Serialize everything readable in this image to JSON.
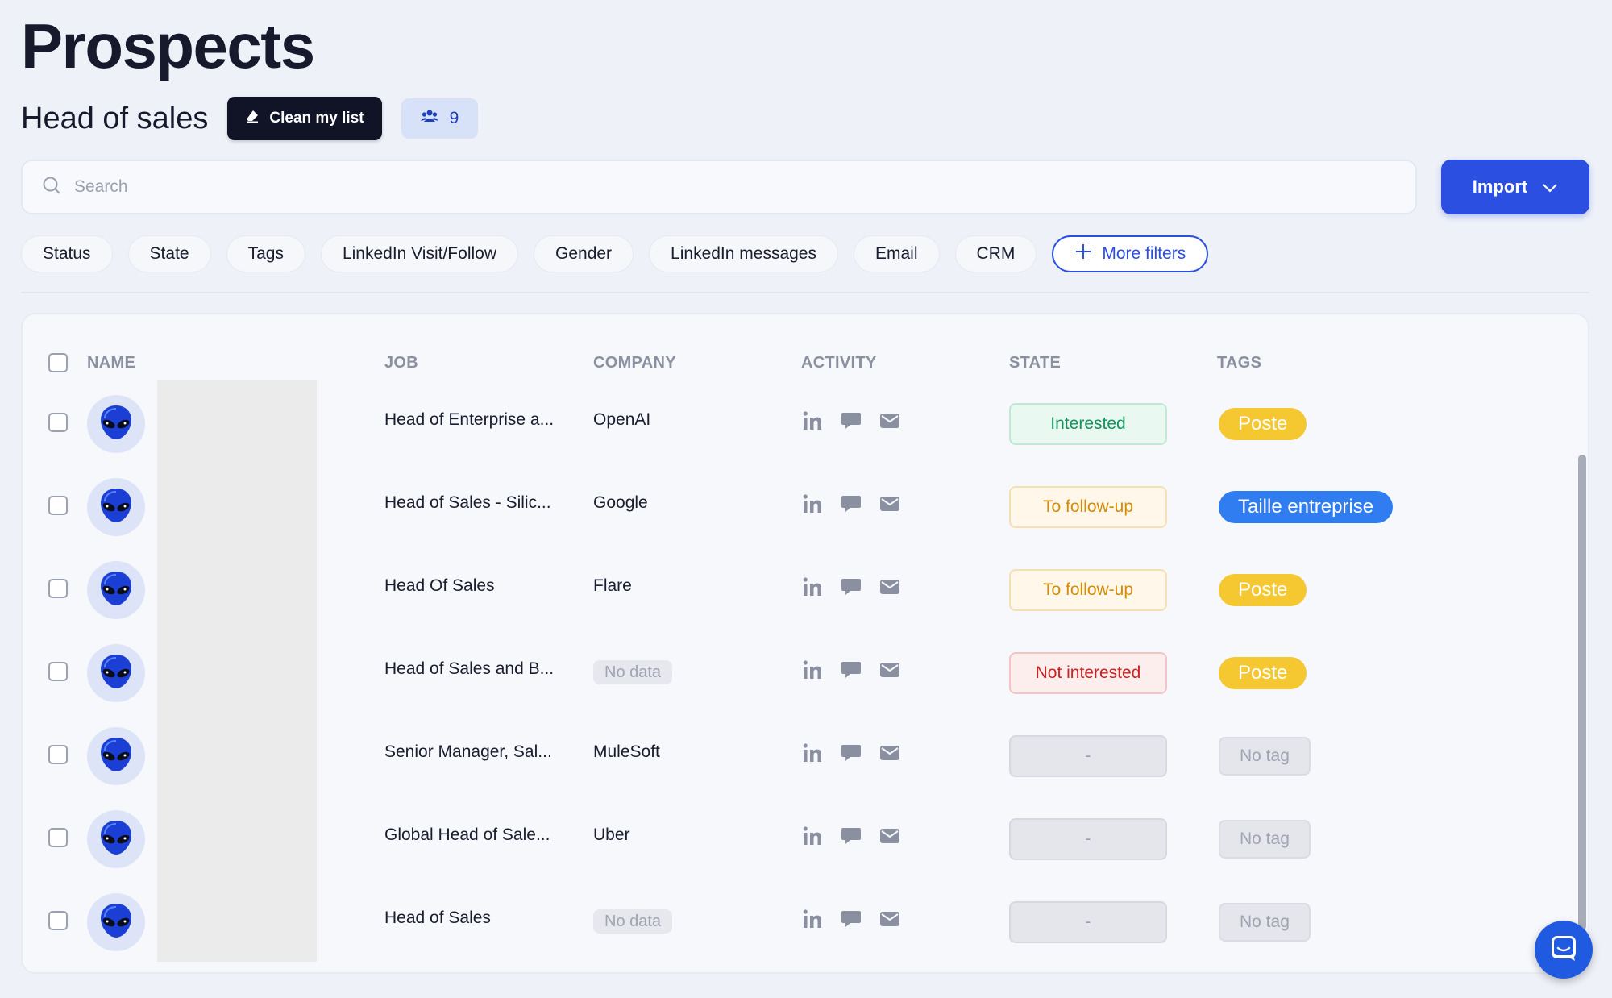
{
  "page": {
    "title": "Prospects"
  },
  "list": {
    "name": "Head of sales",
    "clean_label": "Clean my list",
    "count": "9"
  },
  "search": {
    "placeholder": "Search",
    "value": ""
  },
  "import": {
    "label": "Import"
  },
  "filters": [
    "Status",
    "State",
    "Tags",
    "LinkedIn Visit/Follow",
    "Gender",
    "LinkedIn messages",
    "Email",
    "CRM"
  ],
  "more_filters_label": "More filters",
  "table": {
    "columns": {
      "name": "NAME",
      "job": "JOB",
      "company": "COMPANY",
      "activity": "ACTIVITY",
      "state": "STATE",
      "tags": "TAGS"
    },
    "rows": [
      {
        "job": "Head of Enterprise a...",
        "company": "OpenAI",
        "company_nodata": false,
        "state": "Interested",
        "state_kind": "interested",
        "tag": "Poste",
        "tag_kind": "poste"
      },
      {
        "job": "Head of Sales - Silic...",
        "company": "Google",
        "company_nodata": false,
        "state": "To follow-up",
        "state_kind": "followup",
        "tag": "Taille entreprise",
        "tag_kind": "taille"
      },
      {
        "job": "Head Of Sales",
        "company": "Flare",
        "company_nodata": false,
        "state": "To follow-up",
        "state_kind": "followup",
        "tag": "Poste",
        "tag_kind": "poste"
      },
      {
        "job": "Head of Sales and B...",
        "company": "No data",
        "company_nodata": true,
        "state": "Not interested",
        "state_kind": "notint",
        "tag": "Poste",
        "tag_kind": "poste"
      },
      {
        "job": "Senior Manager, Sal...",
        "company": "MuleSoft",
        "company_nodata": false,
        "state": "-",
        "state_kind": "empty",
        "tag": "No tag",
        "tag_kind": "notag"
      },
      {
        "job": "Global Head of Sale...",
        "company": "Uber",
        "company_nodata": false,
        "state": "-",
        "state_kind": "empty",
        "tag": "No tag",
        "tag_kind": "notag"
      },
      {
        "job": "Head of Sales",
        "company": "No data",
        "company_nodata": true,
        "state": "-",
        "state_kind": "empty",
        "tag": "No tag",
        "tag_kind": "notag"
      }
    ]
  },
  "colors": {
    "accent": "#2b4fe0",
    "interested": "#14935c",
    "followup": "#d48c06",
    "not_interested": "#cc2222",
    "tag_poste": "#f5c730",
    "tag_taille": "#2f7df0"
  },
  "icons": [
    "search-icon",
    "eraser-icon",
    "users-icon",
    "chevron-down-icon",
    "plus-icon",
    "linkedin-icon",
    "chat-icon",
    "mail-icon",
    "alien-avatar-icon",
    "chat-bubble-icon"
  ]
}
